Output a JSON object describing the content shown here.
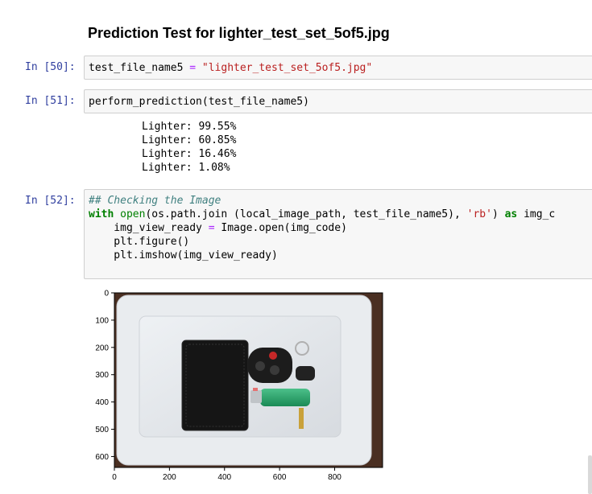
{
  "heading": "Prediction Test for lighter_test_set_5of5.jpg",
  "cells": [
    {
      "prompt": "In [50]:",
      "code": {
        "var": "test_file_name5 ",
        "eq": "=",
        "str": " \"lighter_test_set_5of5.jpg\""
      }
    },
    {
      "prompt": "In [51]:",
      "code": {
        "fn": "perform_prediction",
        "paren_open": "(",
        "arg": "test_file_name5",
        "paren_close": ")"
      },
      "output": [
        "Lighter: 99.55%",
        "Lighter: 60.85%",
        "Lighter: 16.46%",
        "Lighter: 1.08%"
      ]
    },
    {
      "prompt": "In [52]:",
      "code": {
        "comment": "## Checking the Image",
        "l2_with": "with",
        "l2_open": "open",
        "l2_mid": "(os.path.join (local_image_path, test_file_name5), ",
        "l2_str": "'rb'",
        "l2_close": ") ",
        "l2_as": "as",
        "l2_tail": " img_c",
        "l3_var": "    img_view_ready ",
        "l3_eq": "=",
        "l3_rest": " Image.open(img_code)",
        "l4": "    plt.figure()",
        "l5": "    plt.imshow(img_view_ready)"
      }
    }
  ],
  "plot": {
    "y_ticks": [
      "0",
      "100",
      "200",
      "300",
      "400",
      "500",
      "600"
    ],
    "x_ticks": [
      "0",
      "200",
      "400",
      "600",
      "800"
    ],
    "image_extent": {
      "width": 974,
      "height": 640
    }
  },
  "colors": {
    "prompt": "#303f9f",
    "string": "#ba2121",
    "keyword": "#008000",
    "operator": "#aa22ff",
    "comment": "#408080"
  }
}
